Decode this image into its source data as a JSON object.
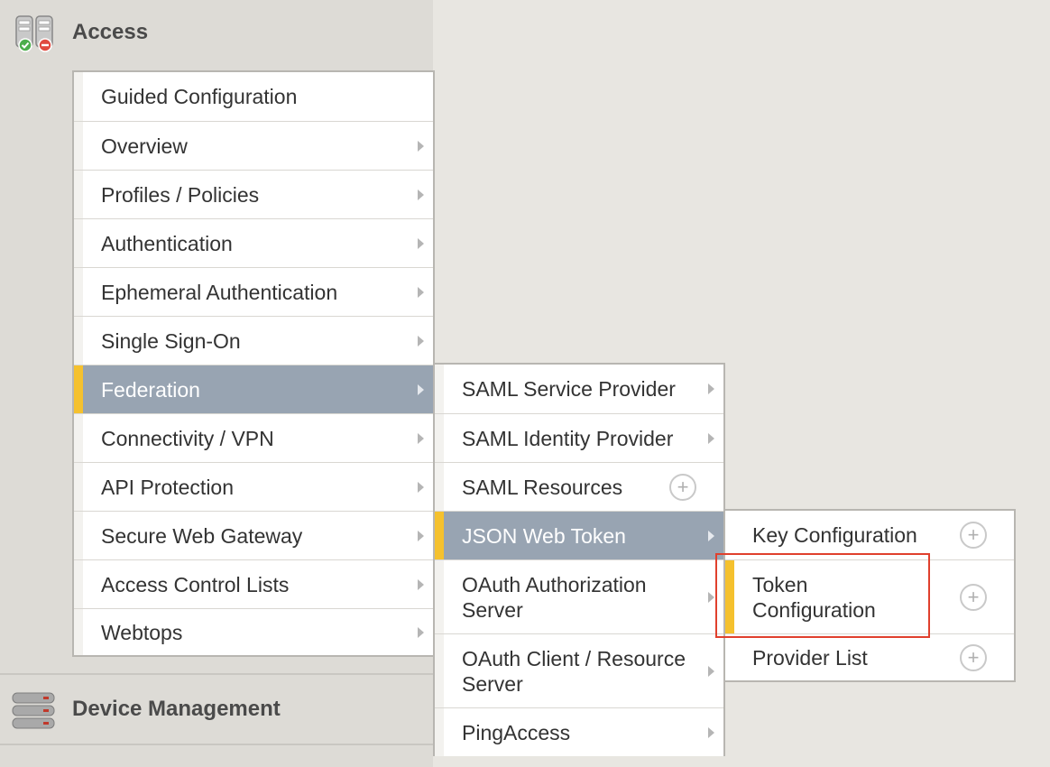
{
  "sections": {
    "access": {
      "title": "Access"
    },
    "device": {
      "title": "Device Management"
    }
  },
  "menu1": [
    {
      "label": "Guided Configuration",
      "indicator": "none"
    },
    {
      "label": "Overview",
      "indicator": "arrow"
    },
    {
      "label": "Profiles / Policies",
      "indicator": "arrow"
    },
    {
      "label": "Authentication",
      "indicator": "arrow"
    },
    {
      "label": "Ephemeral Authentication",
      "indicator": "arrow"
    },
    {
      "label": "Single Sign-On",
      "indicator": "arrow"
    },
    {
      "label": "Federation",
      "indicator": "arrow",
      "active": true
    },
    {
      "label": "Connectivity / VPN",
      "indicator": "arrow"
    },
    {
      "label": "API Protection",
      "indicator": "arrow"
    },
    {
      "label": "Secure Web Gateway",
      "indicator": "arrow"
    },
    {
      "label": "Access Control Lists",
      "indicator": "arrow"
    },
    {
      "label": "Webtops",
      "indicator": "arrow"
    }
  ],
  "menu2": [
    {
      "label": "SAML Service Provider",
      "indicator": "arrow"
    },
    {
      "label": "SAML Identity Provider",
      "indicator": "arrow"
    },
    {
      "label": "SAML Resources",
      "indicator": "plus"
    },
    {
      "label": "JSON Web Token",
      "indicator": "arrow",
      "active": true
    },
    {
      "label": "OAuth Authorization\nServer",
      "indicator": "arrow"
    },
    {
      "label": "OAuth Client / Resource\nServer",
      "indicator": "arrow"
    },
    {
      "label": "PingAccess",
      "indicator": "arrow"
    }
  ],
  "menu3": [
    {
      "label": "Key Configuration",
      "indicator": "plus"
    },
    {
      "label": "Token\nConfiguration",
      "indicator": "plus",
      "accent": true,
      "highlighted": true
    },
    {
      "label": "Provider List",
      "indicator": "plus"
    }
  ],
  "icons": {
    "access": "access-servers-icon",
    "device": "device-stack-icon",
    "submenu": "chevron-right-icon",
    "add": "plus-circle-icon"
  },
  "colors": {
    "active_bg": "#98a4b2",
    "accent": "#f5c12e",
    "highlight": "#e0402d"
  }
}
